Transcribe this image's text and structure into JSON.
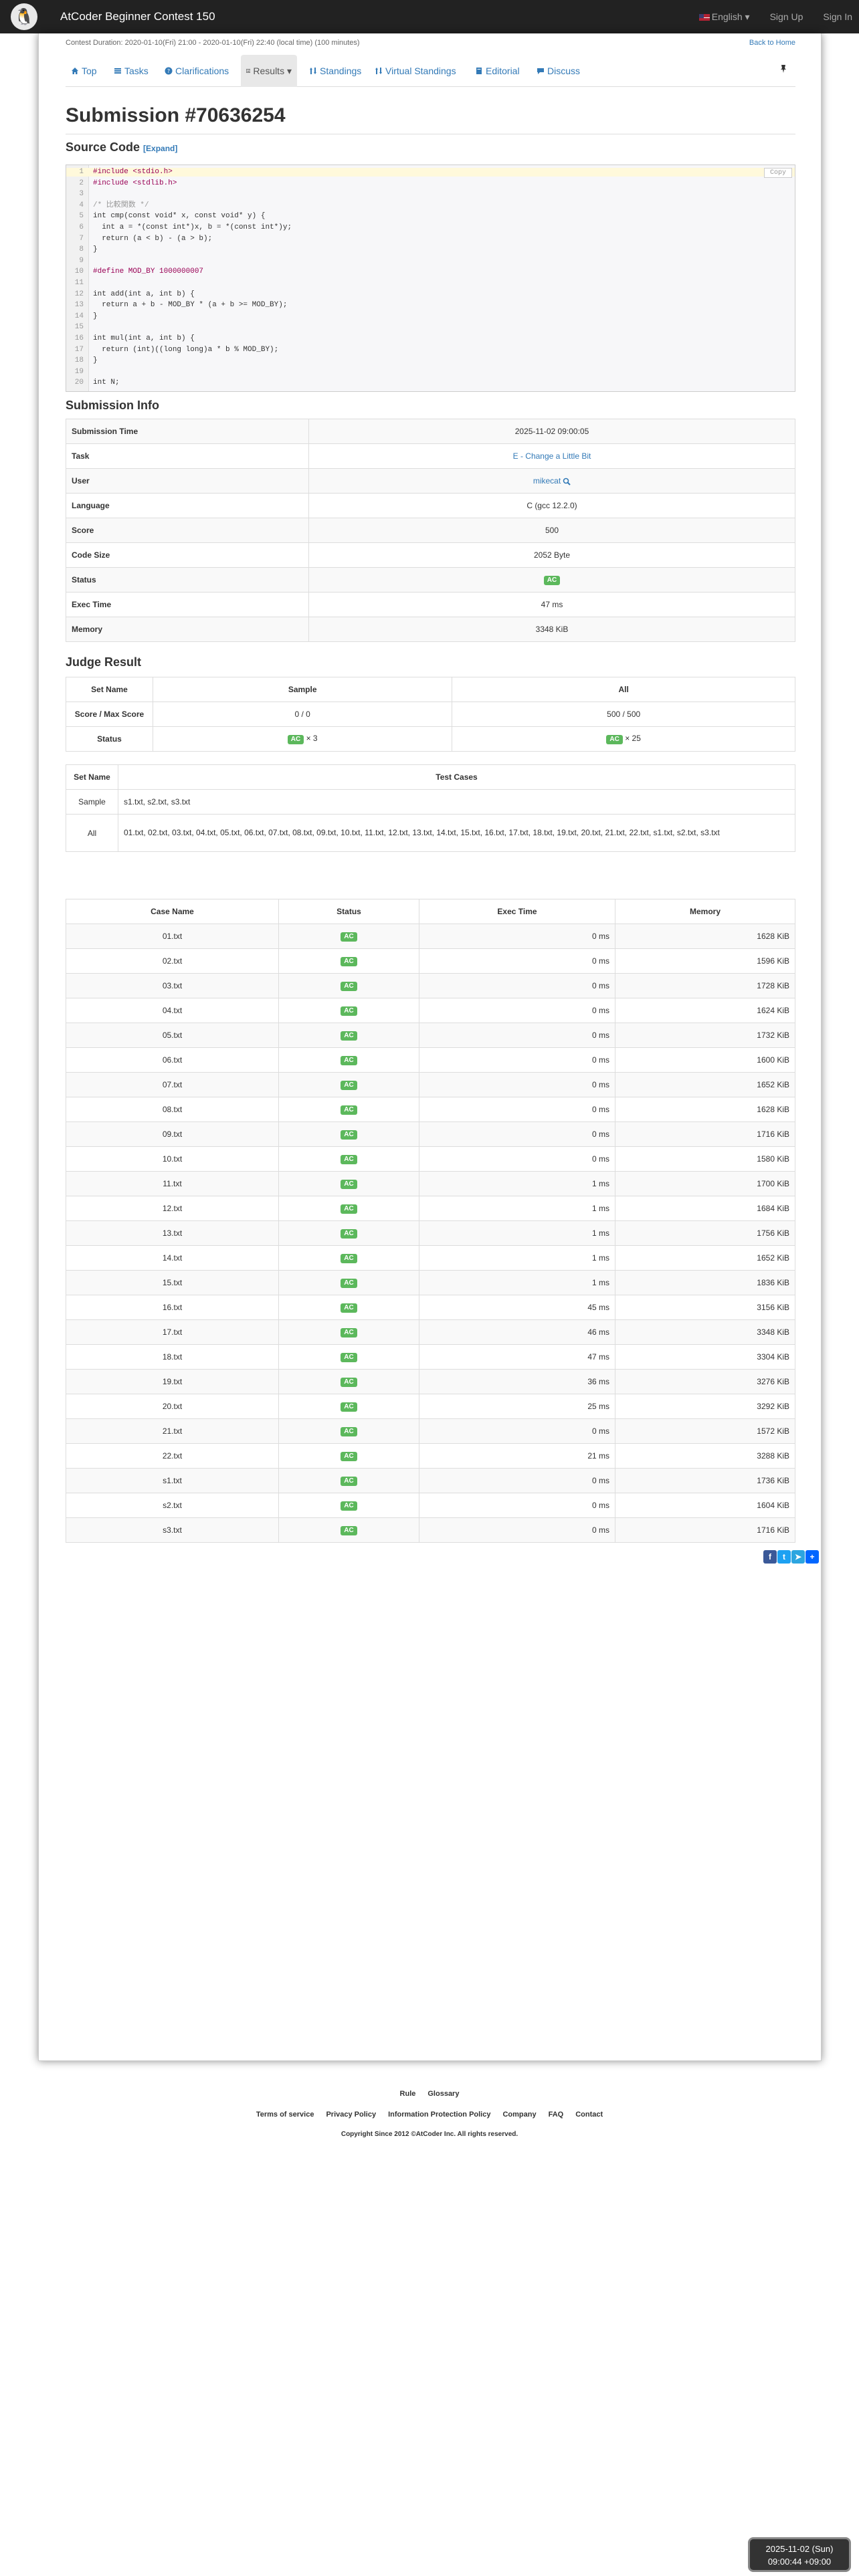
{
  "navbar": {
    "logo_glyph": "🐧",
    "contest_name": "AtCoder Beginner Contest 150",
    "language": "English",
    "sign_up": "Sign Up",
    "sign_in": "Sign In"
  },
  "duration": "Contest Duration: 2020-01-10(Fri) 21:00 - 2020-01-10(Fri) 22:40 (local time) (100 minutes)",
  "back_home": "Back to Home",
  "tabs": {
    "top": "Top",
    "tasks": "Tasks",
    "clarifications": "Clarifications",
    "results": "Results",
    "standings": "Standings",
    "virtual": "Virtual Standings",
    "editorial": "Editorial",
    "discuss": "Discuss"
  },
  "title": "Submission #70636254",
  "source_heading": "Source Code",
  "expand": "[Expand]",
  "copy_label": "Copy",
  "code_lines": [
    "#include <stdio.h>",
    "#include <stdlib.h>",
    "",
    "/* 比較関数 */",
    "int cmp(const void* x, const void* y) {",
    "  int a = *(const int*)x, b = *(const int*)y;",
    "  return (a < b) - (a > b);",
    "}",
    "",
    "#define MOD_BY 1000000007",
    "",
    "int add(int a, int b) {",
    "  return a + b - MOD_BY * (a + b >= MOD_BY);",
    "}",
    "",
    "int mul(int a, int b) {",
    "  return (int)((long long)a * b % MOD_BY);",
    "}",
    "",
    "int N;"
  ],
  "info_heading": "Submission Info",
  "info": [
    {
      "k": "Submission Time",
      "v": "2025-11-02 09:00:05"
    },
    {
      "k": "Task",
      "v": "E - Change a Little Bit"
    },
    {
      "k": "User",
      "v": "mikecat"
    },
    {
      "k": "Language",
      "v": "C (gcc 12.2.0)"
    },
    {
      "k": "Score",
      "v": "500"
    },
    {
      "k": "Code Size",
      "v": "2052 Byte"
    },
    {
      "k": "Status",
      "v": "AC"
    },
    {
      "k": "Exec Time",
      "v": "47 ms"
    },
    {
      "k": "Memory",
      "v": "3348 KiB"
    }
  ],
  "judge_heading": "Judge Result",
  "judge": {
    "h_set": "Set Name",
    "h_sample": "Sample",
    "h_all": "All",
    "r_score": "Score / Max Score",
    "score_sample": "0 / 0",
    "score_all": "500 / 500",
    "r_status": "Status",
    "status_ac": "AC",
    "sample_count": "× 3",
    "all_count": "× 25"
  },
  "testcases": {
    "h_set": "Set Name",
    "h_cases": "Test Cases",
    "sample_name": "Sample",
    "sample_cases": "s1.txt, s2.txt, s3.txt",
    "all_name": "All",
    "all_cases": "01.txt, 02.txt, 03.txt, 04.txt, 05.txt, 06.txt, 07.txt, 08.txt, 09.txt, 10.txt, 11.txt, 12.txt, 13.txt, 14.txt, 15.txt, 16.txt, 17.txt, 18.txt, 19.txt, 20.txt, 21.txt, 22.txt, s1.txt, s2.txt, s3.txt"
  },
  "cases_header": {
    "name": "Case Name",
    "status": "Status",
    "time": "Exec Time",
    "memory": "Memory"
  },
  "cases": [
    [
      "01.txt",
      "AC",
      "0 ms",
      "1628 KiB"
    ],
    [
      "02.txt",
      "AC",
      "0 ms",
      "1596 KiB"
    ],
    [
      "03.txt",
      "AC",
      "0 ms",
      "1728 KiB"
    ],
    [
      "04.txt",
      "AC",
      "0 ms",
      "1624 KiB"
    ],
    [
      "05.txt",
      "AC",
      "0 ms",
      "1732 KiB"
    ],
    [
      "06.txt",
      "AC",
      "0 ms",
      "1600 KiB"
    ],
    [
      "07.txt",
      "AC",
      "0 ms",
      "1652 KiB"
    ],
    [
      "08.txt",
      "AC",
      "0 ms",
      "1628 KiB"
    ],
    [
      "09.txt",
      "AC",
      "0 ms",
      "1716 KiB"
    ],
    [
      "10.txt",
      "AC",
      "0 ms",
      "1580 KiB"
    ],
    [
      "11.txt",
      "AC",
      "1 ms",
      "1700 KiB"
    ],
    [
      "12.txt",
      "AC",
      "1 ms",
      "1684 KiB"
    ],
    [
      "13.txt",
      "AC",
      "1 ms",
      "1756 KiB"
    ],
    [
      "14.txt",
      "AC",
      "1 ms",
      "1652 KiB"
    ],
    [
      "15.txt",
      "AC",
      "1 ms",
      "1836 KiB"
    ],
    [
      "16.txt",
      "AC",
      "45 ms",
      "3156 KiB"
    ],
    [
      "17.txt",
      "AC",
      "46 ms",
      "3348 KiB"
    ],
    [
      "18.txt",
      "AC",
      "47 ms",
      "3304 KiB"
    ],
    [
      "19.txt",
      "AC",
      "36 ms",
      "3276 KiB"
    ],
    [
      "20.txt",
      "AC",
      "25 ms",
      "3292 KiB"
    ],
    [
      "21.txt",
      "AC",
      "0 ms",
      "1572 KiB"
    ],
    [
      "22.txt",
      "AC",
      "21 ms",
      "3288 KiB"
    ],
    [
      "s1.txt",
      "AC",
      "0 ms",
      "1736 KiB"
    ],
    [
      "s2.txt",
      "AC",
      "0 ms",
      "1604 KiB"
    ],
    [
      "s3.txt",
      "AC",
      "0 ms",
      "1716 KiB"
    ]
  ],
  "share": {
    "facebook": "f",
    "twitter": "t",
    "telegram": "➤",
    "more": "+"
  },
  "footer": {
    "rule": "Rule",
    "glossary": "Glossary",
    "terms": "Terms of service",
    "privacy": "Privacy Policy",
    "info_protection": "Information Protection Policy",
    "company": "Company",
    "faq": "FAQ",
    "contact": "Contact",
    "copyright": "Copyright Since 2012 ©AtCoder Inc. All rights reserved."
  },
  "clock": {
    "date": "2025-11-02 (Sun)",
    "time": "09:00:44 +09:00"
  },
  "colors": {
    "navbar": "#222222",
    "link": "#337ab7",
    "ac": "#5cb85c"
  }
}
